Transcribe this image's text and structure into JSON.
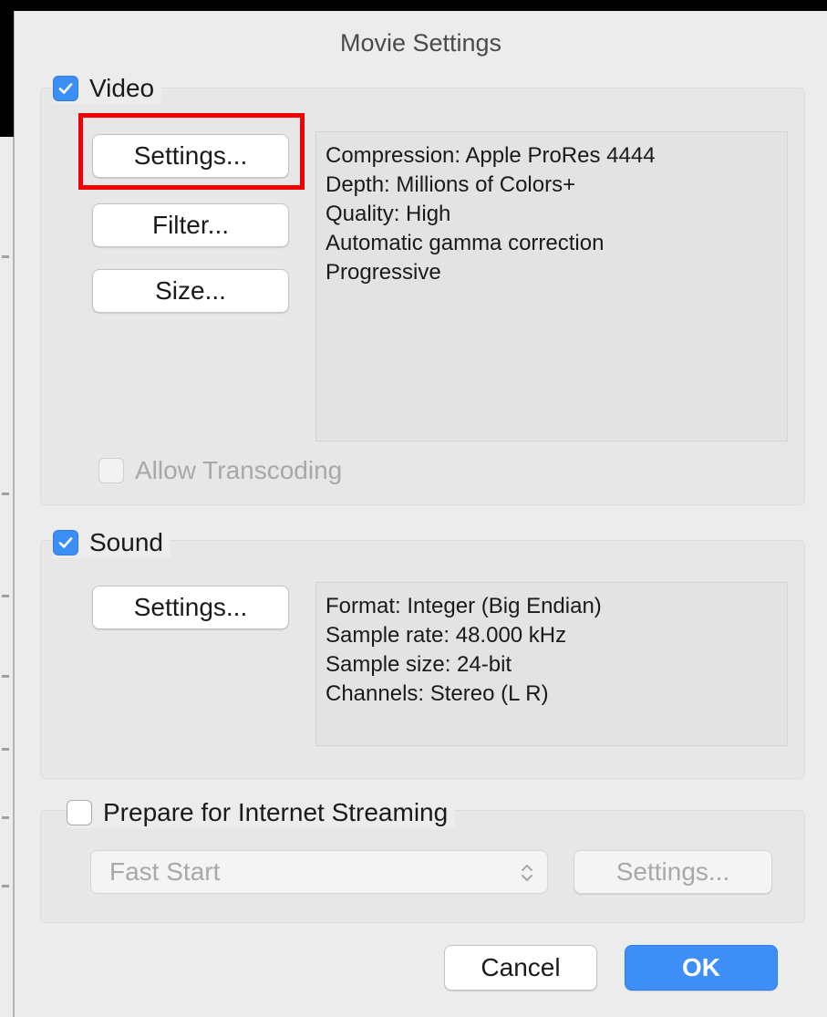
{
  "dialog": {
    "title": "Movie Settings"
  },
  "video": {
    "label": "Video",
    "checked": true,
    "buttons": {
      "settings": "Settings...",
      "filter": "Filter...",
      "size": "Size..."
    },
    "info_lines": [
      "Compression: Apple ProRes 4444",
      "Depth: Millions of Colors+",
      "Quality: High",
      "Automatic gamma correction",
      "Progressive"
    ],
    "allow_transcoding": {
      "label": "Allow Transcoding",
      "checked": false,
      "disabled": true
    }
  },
  "sound": {
    "label": "Sound",
    "checked": true,
    "buttons": {
      "settings": "Settings..."
    },
    "info_lines": [
      "Format: Integer (Big Endian)",
      "Sample rate: 48.000 kHz",
      "Sample size: 24-bit",
      "Channels: Stereo (L R)"
    ]
  },
  "streaming": {
    "label": "Prepare for Internet Streaming",
    "checked": false,
    "select_value": "Fast Start",
    "settings_label": "Settings..."
  },
  "footer": {
    "cancel_label": "Cancel",
    "ok_label": "OK"
  },
  "colors": {
    "accent": "#3d8ef7",
    "highlight": "#f20000"
  },
  "icons": {
    "checkmark": "checkmark-icon",
    "select_arrows": "up-down-chevron-icon"
  }
}
